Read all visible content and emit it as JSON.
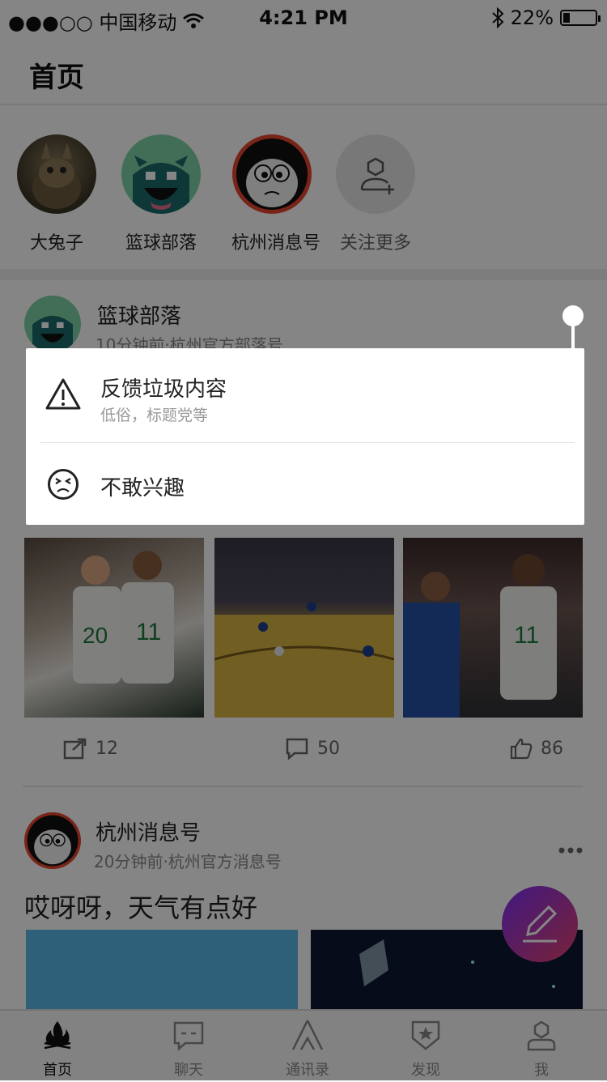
{
  "status_bar": {
    "carrier": "●●●○○ 中国移动",
    "time": "4:21 PM",
    "battery": "22%",
    "battery_level": 0.22
  },
  "header": {
    "title": "首页"
  },
  "follows": [
    {
      "name": "大兔子"
    },
    {
      "name": "篮球部落"
    },
    {
      "name": "杭州消息号"
    },
    {
      "name": "关注更多"
    }
  ],
  "post1": {
    "author": "篮球部落",
    "meta": "10分钟前·杭州官方部落号",
    "share_count": "12",
    "comment_count": "50",
    "like_count": "86"
  },
  "post2": {
    "author": "杭州消息号",
    "meta": "20分钟前·杭州官方消息号",
    "text": "哎呀呀，天气有点好"
  },
  "popup": {
    "report_title": "反馈垃圾内容",
    "report_sub": "低俗，标题党等",
    "not_interested": "不敢兴趣"
  },
  "tabs": [
    {
      "label": "首页",
      "icon": "fire-icon"
    },
    {
      "label": "聊天",
      "icon": "chat-icon"
    },
    {
      "label": "通讯录",
      "icon": "tent-icon"
    },
    {
      "label": "发现",
      "icon": "badge-star-icon"
    },
    {
      "label": "我",
      "icon": "user-icon"
    }
  ],
  "colors": {
    "fab_start": "#7b2ff7",
    "fab_end": "#e9436b",
    "overlay": "rgba(0,0,0,0.48)"
  }
}
